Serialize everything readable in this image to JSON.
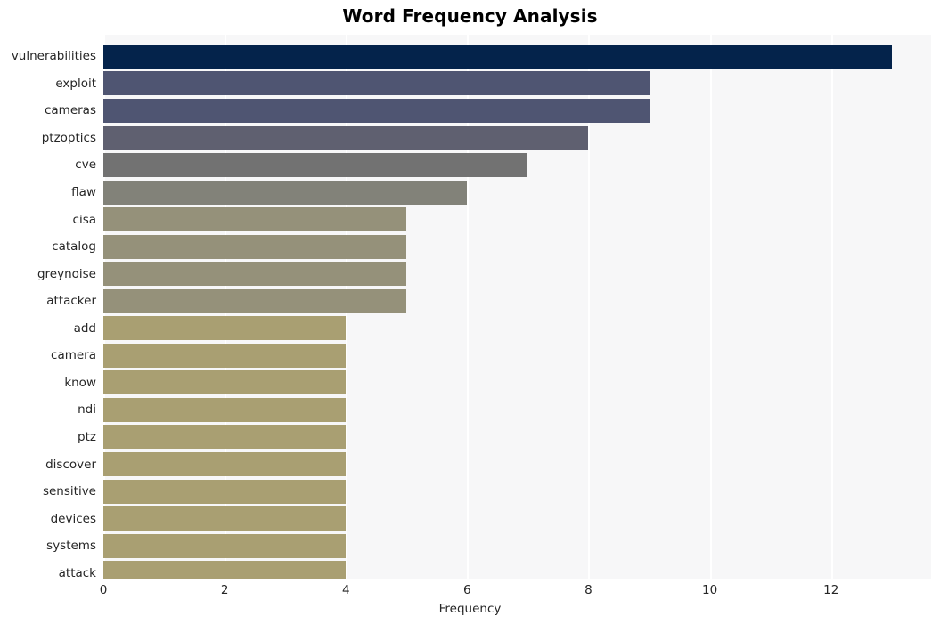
{
  "chart_data": {
    "type": "bar",
    "orientation": "horizontal",
    "title": "Word Frequency Analysis",
    "xlabel": "Frequency",
    "ylabel": "",
    "xlim": [
      0,
      13.65
    ],
    "xticks": [
      0,
      2,
      4,
      6,
      8,
      10,
      12
    ],
    "xtick_labels": [
      "0",
      "2",
      "4",
      "6",
      "8",
      "10",
      "12"
    ],
    "grid": "vertical",
    "legend": "none",
    "categories": [
      "vulnerabilities",
      "exploit",
      "cameras",
      "ptzoptics",
      "cve",
      "flaw",
      "cisa",
      "catalog",
      "greynoise",
      "attacker",
      "add",
      "camera",
      "know",
      "ndi",
      "ptz",
      "discover",
      "sensitive",
      "devices",
      "systems",
      "attack"
    ],
    "values": [
      13,
      9,
      9,
      8,
      7,
      6,
      5,
      5,
      5,
      5,
      4,
      4,
      4,
      4,
      4,
      4,
      4,
      4,
      4,
      4
    ],
    "bar_colors": [
      "#04234b",
      "#4f5572",
      "#4f5572",
      "#5f6070",
      "#727272",
      "#828279",
      "#95917a",
      "#95917a",
      "#95917a",
      "#95917a",
      "#a99f72",
      "#a99f72",
      "#a99f72",
      "#a99f72",
      "#a99f72",
      "#a99f72",
      "#a99f72",
      "#a99f72",
      "#a99f72",
      "#a99f72"
    ]
  },
  "style": {
    "plot_background": "#f7f7f8",
    "gridline_color": "#ffffff",
    "text_color": "#262626",
    "title_color": "#000000",
    "canvas_background": "#ffffff"
  }
}
